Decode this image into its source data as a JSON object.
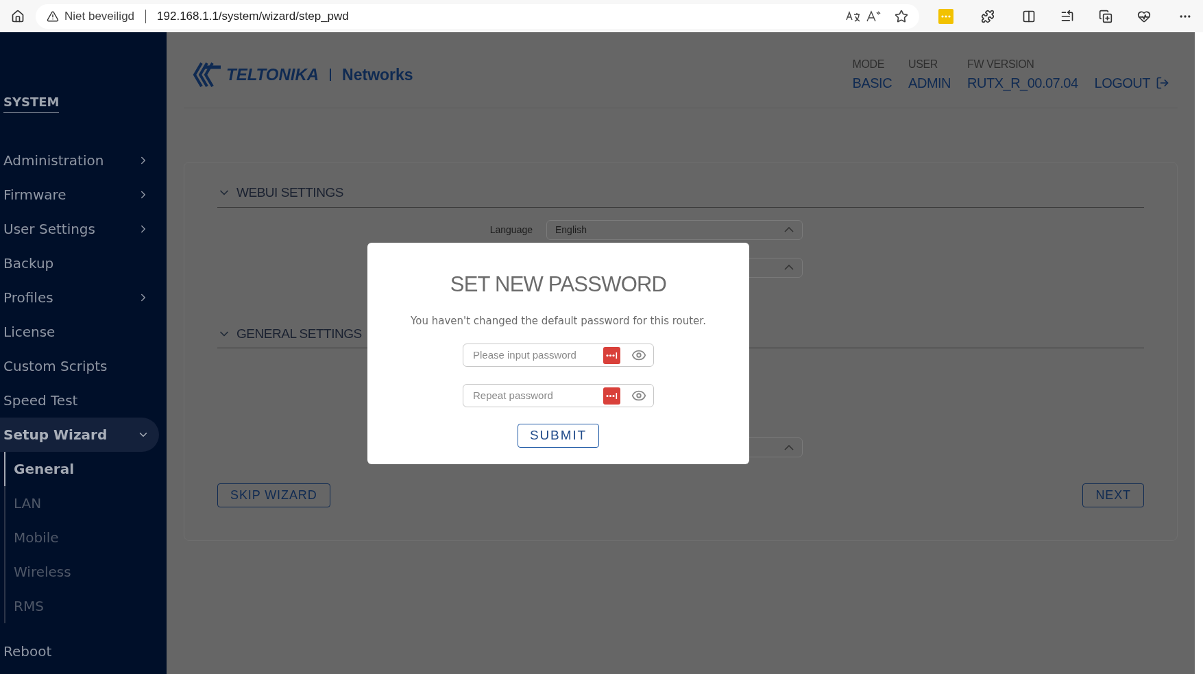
{
  "browser": {
    "warning": "Niet beveiligd",
    "url": "192.168.1.1/system/wizard/step_pwd"
  },
  "sidebar": {
    "title": "SYSTEM",
    "items": [
      {
        "label": "Administration",
        "kind": "submenu",
        "expanded": false,
        "selected": false
      },
      {
        "label": "Firmware",
        "kind": "submenu",
        "expanded": false,
        "selected": false
      },
      {
        "label": "User Settings",
        "kind": "submenu",
        "expanded": false,
        "selected": false
      },
      {
        "label": "Backup",
        "kind": "link",
        "selected": false
      },
      {
        "label": "Profiles",
        "kind": "submenu",
        "expanded": false,
        "selected": false
      },
      {
        "label": "License",
        "kind": "link",
        "selected": false
      },
      {
        "label": "Custom Scripts",
        "kind": "link",
        "selected": false
      },
      {
        "label": "Speed Test",
        "kind": "link",
        "selected": false
      },
      {
        "label": "Setup Wizard",
        "kind": "submenu",
        "expanded": true,
        "selected": true,
        "children": [
          {
            "label": "General",
            "selected": true
          },
          {
            "label": "LAN",
            "selected": false
          },
          {
            "label": "Mobile",
            "selected": false
          },
          {
            "label": "Wireless",
            "selected": false
          },
          {
            "label": "RMS",
            "selected": false
          }
        ]
      },
      {
        "label": "Reboot",
        "kind": "link",
        "selected": false
      }
    ]
  },
  "header": {
    "logo": "TELTONIKA",
    "logo_suffix": "Networks",
    "info": [
      {
        "label": "MODE",
        "value": "BASIC"
      },
      {
        "label": "USER",
        "value": "ADMIN"
      },
      {
        "label": "FW VERSION",
        "value": "RUTX_R_00.07.04"
      }
    ],
    "logout": "LOGOUT"
  },
  "wizard": {
    "sections": [
      {
        "title": "WEBUI SETTINGS",
        "expanded": true,
        "fields": [
          {
            "kind": "select",
            "label": "Language",
            "value": "English"
          },
          {
            "kind": "select"
          }
        ]
      },
      {
        "title": "GENERAL SETTINGS",
        "expanded": true,
        "fields": [
          {
            "kind": "select"
          }
        ]
      }
    ],
    "skip": "SKIP WIZARD",
    "next": "NEXT"
  },
  "modal": {
    "title": "SET NEW PASSWORD",
    "message": "You haven't changed the default password for this router.",
    "fields": [
      {
        "placeholder": "Please input password"
      },
      {
        "placeholder": "Repeat password"
      }
    ],
    "submit": "SUBMIT"
  }
}
